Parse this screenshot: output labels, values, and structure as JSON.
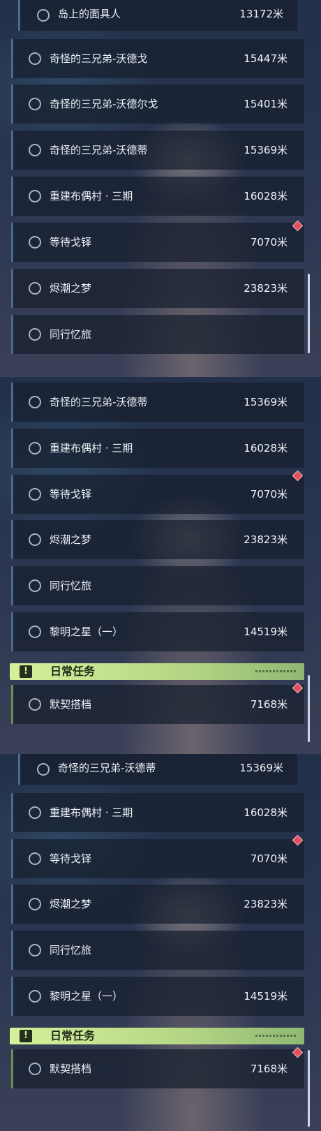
{
  "screens": [
    {
      "rows": [
        {
          "name": "岛上的面具人",
          "distance": "13172米"
        },
        {
          "name": "奇怪的三兄弟-沃德戈",
          "distance": "15447米"
        },
        {
          "name": "奇怪的三兄弟-沃德尔戈",
          "distance": "15401米"
        },
        {
          "name": "奇怪的三兄弟-沃德蒂",
          "distance": "15369米"
        },
        {
          "name": "重建布偶村 · 三期",
          "distance": "16028米"
        },
        {
          "name": "等待戈铎",
          "distance": "7070米"
        },
        {
          "name": "烬潮之梦",
          "distance": "23823米"
        },
        {
          "name": "同行忆旅",
          "distance": ""
        }
      ]
    },
    {
      "rows": [
        {
          "name": "奇怪的三兄弟-沃德蒂",
          "distance": "15369米"
        },
        {
          "name": "重建布偶村 · 三期",
          "distance": "16028米"
        },
        {
          "name": "等待戈铎",
          "distance": "7070米"
        },
        {
          "name": "烬潮之梦",
          "distance": "23823米"
        },
        {
          "name": "同行忆旅",
          "distance": ""
        },
        {
          "name": "黎明之星（一）",
          "distance": "14519米"
        }
      ],
      "section_title": "日常任务",
      "section_icon": "!",
      "daily": {
        "name": "默契搭档",
        "distance": "7168米"
      }
    },
    {
      "rows": [
        {
          "name": "奇怪的三兄弟-沃德蒂",
          "distance": "15369米"
        },
        {
          "name": "重建布偶村 · 三期",
          "distance": "16028米"
        },
        {
          "name": "等待戈铎",
          "distance": "7070米"
        },
        {
          "name": "烬潮之梦",
          "distance": "23823米"
        },
        {
          "name": "同行忆旅",
          "distance": ""
        },
        {
          "name": "黎明之星（一）",
          "distance": "14519米"
        }
      ],
      "section_title": "日常任务",
      "section_icon": "!",
      "daily": {
        "name": "默契搭档",
        "distance": "7168米"
      }
    }
  ],
  "colors": {
    "accent_green": "#d7f09a",
    "marker_red": "#e0505d",
    "row_border": "#4d6a88"
  },
  "icons": {
    "quest_status": "circle-outline-icon",
    "tracked_marker": "diamond-marker-icon",
    "section_header": "exclamation-icon"
  }
}
